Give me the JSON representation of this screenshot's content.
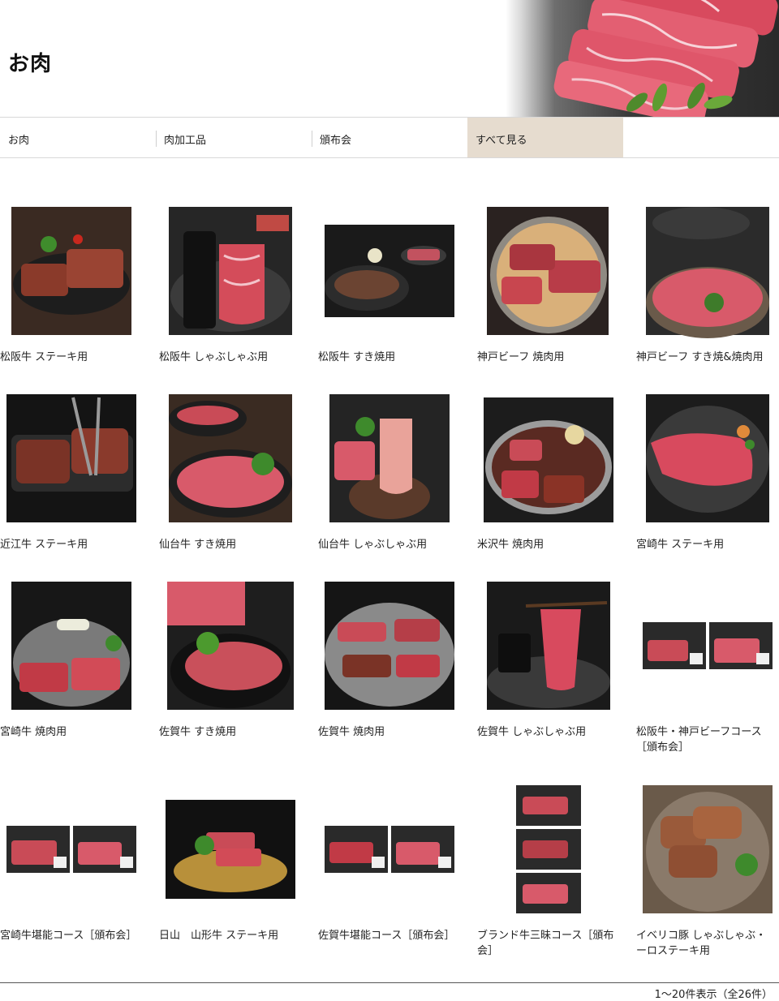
{
  "page_title": "お肉",
  "tabs": [
    {
      "label": "お肉"
    },
    {
      "label": "肉加工品"
    },
    {
      "label": "頒布会"
    },
    {
      "label": "すべて見る"
    }
  ],
  "products": [
    {
      "name": "松阪牛 ステーキ用"
    },
    {
      "name": "松阪牛 しゃぶしゃぶ用"
    },
    {
      "name": "松阪牛 すき焼用"
    },
    {
      "name": "神戸ビーフ 焼肉用"
    },
    {
      "name": "神戸ビーフ すき焼&焼肉用"
    },
    {
      "name": "近江牛 ステーキ用"
    },
    {
      "name": "仙台牛 すき焼用"
    },
    {
      "name": "仙台牛 しゃぶしゃぶ用"
    },
    {
      "name": "米沢牛 焼肉用"
    },
    {
      "name": "宮崎牛 ステーキ用"
    },
    {
      "name": "宮崎牛 焼肉用"
    },
    {
      "name": "佐賀牛 すき焼用"
    },
    {
      "name": "佐賀牛 焼肉用"
    },
    {
      "name": "佐賀牛 しゃぶしゃぶ用"
    },
    {
      "name": "松阪牛・神戸ビーフコース［頒布会］"
    },
    {
      "name": "宮崎牛堪能コース［頒布会］"
    },
    {
      "name": "日山　山形牛 ステーキ用"
    },
    {
      "name": "佐賀牛堪能コース［頒布会］"
    },
    {
      "name": "ブランド牛三昧コース［頒布会］"
    },
    {
      "name": "イベリコ豚 しゃぶしゃぶ・ーロステーキ用"
    }
  ],
  "result_count": "1～20件表示（全26件）"
}
